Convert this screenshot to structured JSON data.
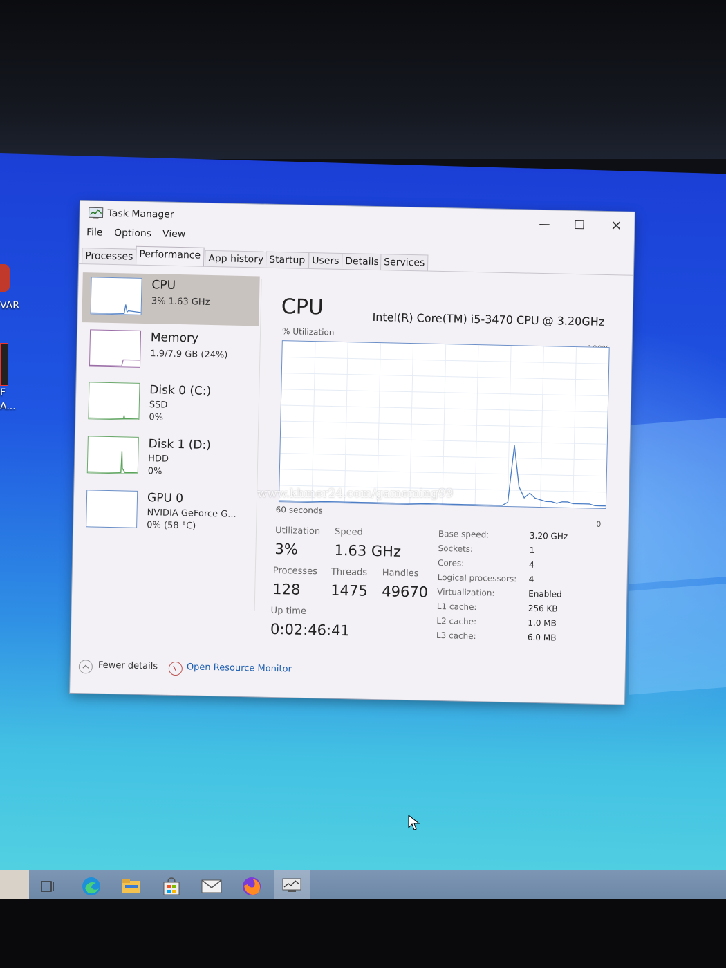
{
  "window": {
    "title": "Task Manager",
    "menu": [
      "File",
      "Options",
      "View"
    ],
    "tabs": [
      {
        "label": "Processes"
      },
      {
        "label": "Performance",
        "active": true
      },
      {
        "label": "App history"
      },
      {
        "label": "Startup"
      },
      {
        "label": "Users"
      },
      {
        "label": "Details"
      },
      {
        "label": "Services"
      }
    ]
  },
  "resources": [
    {
      "name": "CPU",
      "line1": "3%  1.63 GHz",
      "line2": "",
      "selected": true
    },
    {
      "name": "Memory",
      "line1": "1.9/7.9 GB (24%)",
      "line2": ""
    },
    {
      "name": "Disk 0 (C:)",
      "line1": "SSD",
      "line2": "0%"
    },
    {
      "name": "Disk 1 (D:)",
      "line1": "HDD",
      "line2": "0%"
    },
    {
      "name": "GPU 0",
      "line1": "NVIDIA GeForce G...",
      "line2": "0%  (58 °C)"
    }
  ],
  "cpu": {
    "heading": "CPU",
    "model": "Intel(R) Core(TM) i5-3470 CPU @ 3.20GHz",
    "util_label": "% Utilization",
    "max_label": "100%",
    "time_label": "60 seconds",
    "min_label": "0",
    "stats": {
      "utilization_label": "Utilization",
      "utilization": "3%",
      "speed_label": "Speed",
      "speed": "1.63 GHz",
      "processes_label": "Processes",
      "processes": "128",
      "threads_label": "Threads",
      "threads": "1475",
      "handles_label": "Handles",
      "handles": "49670",
      "uptime_label": "Up time",
      "uptime": "0:02:46:41"
    },
    "specs": [
      {
        "label": "Base speed:",
        "value": "3.20 GHz"
      },
      {
        "label": "Sockets:",
        "value": "1"
      },
      {
        "label": "Cores:",
        "value": "4"
      },
      {
        "label": "Logical processors:",
        "value": "4"
      },
      {
        "label": "Virtualization:",
        "value": "Enabled"
      },
      {
        "label": "L1 cache:",
        "value": "256 KB"
      },
      {
        "label": "L2 cache:",
        "value": "1.0 MB"
      },
      {
        "label": "L3 cache:",
        "value": "6.0 MB"
      }
    ],
    "utilization_history": [
      0,
      0,
      0,
      0,
      0,
      0,
      0,
      0,
      0,
      0,
      0,
      0,
      0,
      0,
      0,
      0,
      0,
      0,
      0,
      0,
      0,
      0,
      0,
      0,
      0,
      0,
      0,
      0,
      0,
      0,
      0,
      0,
      0,
      0,
      0,
      0,
      0,
      0,
      0,
      0,
      0,
      0,
      2,
      38,
      12,
      5,
      8,
      5,
      4,
      3,
      3,
      2,
      3,
      3,
      2,
      2,
      2,
      2,
      1,
      1,
      1
    ]
  },
  "footer": {
    "fewer_details": "Fewer details",
    "open_resource_monitor": "Open Resource Monitor"
  },
  "desktop": {
    "icon_labels": [
      "VAR",
      "F",
      "A..."
    ]
  },
  "watermark": "www.khmer24.com/gameming99",
  "colors": {
    "accent_blue": "#1d5fb0",
    "graph_border": "#6b8fc7",
    "graph_line": "#4c7ec6",
    "selection": "#c9c3c0"
  }
}
